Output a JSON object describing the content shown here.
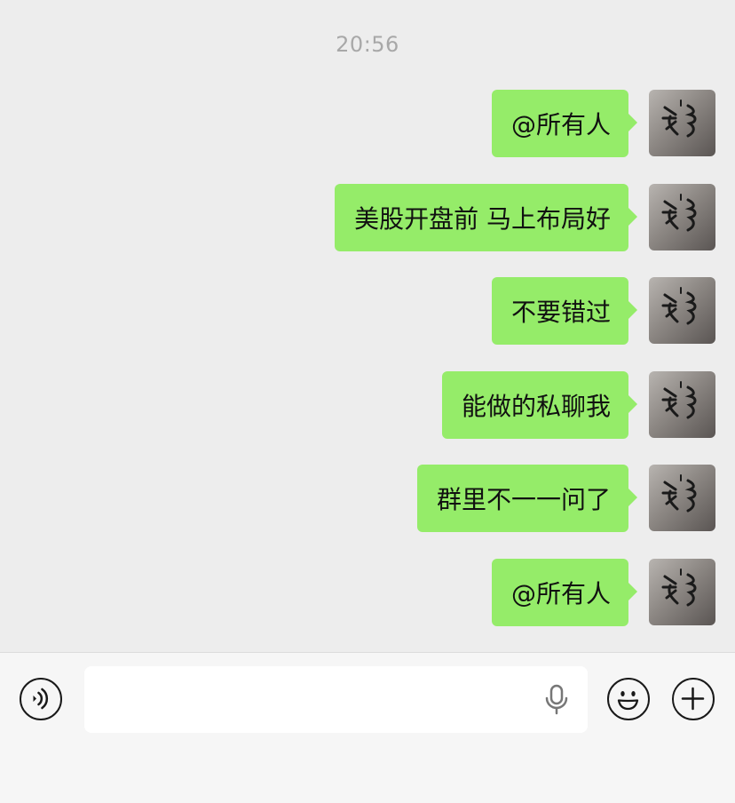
{
  "chat": {
    "timestamp": "20:56",
    "messages": [
      {
        "text": "@所有人"
      },
      {
        "text": "美股开盘前 马上布局好"
      },
      {
        "text": "不要错过"
      },
      {
        "text": "能做的私聊我"
      },
      {
        "text": "群里不一一问了"
      },
      {
        "text": "@所有人"
      }
    ]
  },
  "input_bar": {
    "value": "",
    "icons": [
      "voice-icon",
      "microphone-icon",
      "emoji-icon",
      "plus-icon"
    ]
  },
  "colors": {
    "background": "#ededed",
    "bubble": "#95ec69",
    "input_bar": "#f6f6f6"
  }
}
